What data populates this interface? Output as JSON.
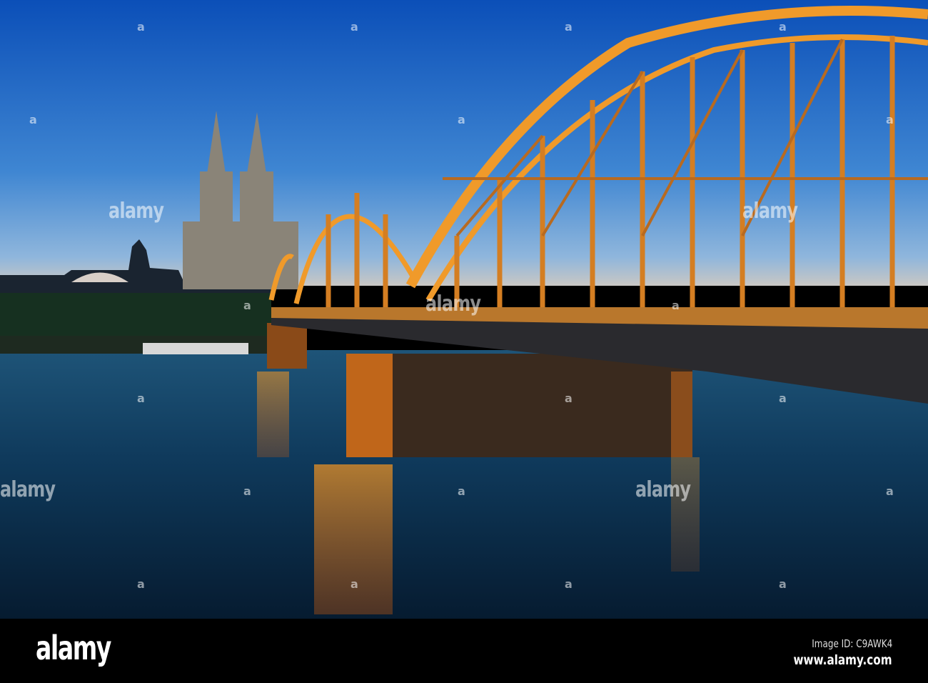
{
  "photo": {
    "subject": "Cologne Cathedral and Hohenzollern Bridge at dusk",
    "colors": {
      "sky_top": "#0b56c2",
      "sky_horizon": "#6fa3d6",
      "water": "#0e3c5e",
      "bridge": "#f09a2a"
    }
  },
  "watermarks": {
    "text": "alamy",
    "glyph": "a"
  },
  "footer": {
    "logo": "alamy",
    "image_id": "Image ID: C9AWK4",
    "website": "www.alamy.com"
  }
}
